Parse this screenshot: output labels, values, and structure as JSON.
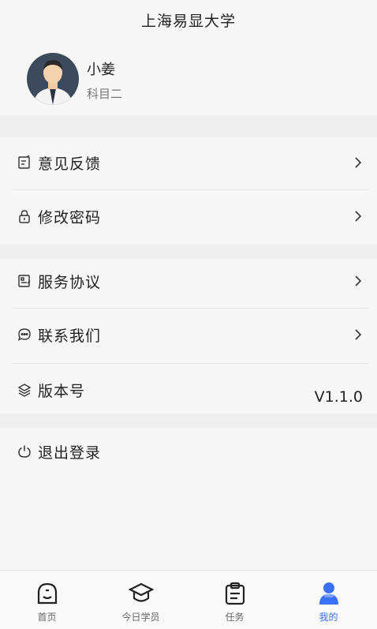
{
  "header": {
    "title": "上海易显大学"
  },
  "profile": {
    "name": "小姜",
    "subject": "科目二"
  },
  "menu": {
    "feedback": "意见反馈",
    "change_password": "修改密码",
    "service_agreement": "服务协议",
    "contact_us": "联系我们",
    "version_label": "版本号",
    "version_value": "V1.1.0",
    "logout": "退出登录"
  },
  "tabs": [
    {
      "label": "首页",
      "icon": "home-face-icon"
    },
    {
      "label": "今日学员",
      "icon": "graduation-cap-icon"
    },
    {
      "label": "任务",
      "icon": "clipboard-icon"
    },
    {
      "label": "我的",
      "icon": "user-icon"
    }
  ],
  "colors": {
    "accent": "#3a6ff7",
    "text": "#222222",
    "subtext": "#777777"
  }
}
